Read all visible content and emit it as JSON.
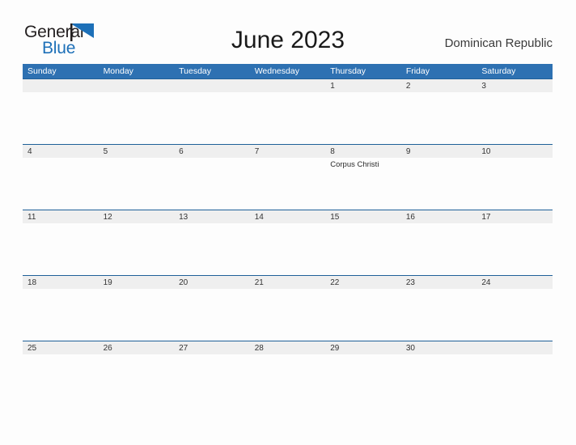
{
  "brand": {
    "name_part1": "General",
    "name_part2": "Blue",
    "flag_color": "#1D70B8",
    "text_color": "#231F20"
  },
  "header": {
    "title": "June 2023",
    "country": "Dominican Republic"
  },
  "theme": {
    "header_blue": "#2E71B2",
    "band_gray": "#EFEFEF",
    "band_line_blue": "#1F6099",
    "page_background": "#FDFDFD"
  },
  "calendar": {
    "weekdays": [
      "Sunday",
      "Monday",
      "Tuesday",
      "Wednesday",
      "Thursday",
      "Friday",
      "Saturday"
    ],
    "weeks": [
      [
        {
          "day": "",
          "events": []
        },
        {
          "day": "",
          "events": []
        },
        {
          "day": "",
          "events": []
        },
        {
          "day": "",
          "events": []
        },
        {
          "day": "1",
          "events": []
        },
        {
          "day": "2",
          "events": []
        },
        {
          "day": "3",
          "events": []
        }
      ],
      [
        {
          "day": "4",
          "events": []
        },
        {
          "day": "5",
          "events": []
        },
        {
          "day": "6",
          "events": []
        },
        {
          "day": "7",
          "events": []
        },
        {
          "day": "8",
          "events": [
            "Corpus Christi"
          ]
        },
        {
          "day": "9",
          "events": []
        },
        {
          "day": "10",
          "events": []
        }
      ],
      [
        {
          "day": "11",
          "events": []
        },
        {
          "day": "12",
          "events": []
        },
        {
          "day": "13",
          "events": []
        },
        {
          "day": "14",
          "events": []
        },
        {
          "day": "15",
          "events": []
        },
        {
          "day": "16",
          "events": []
        },
        {
          "day": "17",
          "events": []
        }
      ],
      [
        {
          "day": "18",
          "events": []
        },
        {
          "day": "19",
          "events": []
        },
        {
          "day": "20",
          "events": []
        },
        {
          "day": "21",
          "events": []
        },
        {
          "day": "22",
          "events": []
        },
        {
          "day": "23",
          "events": []
        },
        {
          "day": "24",
          "events": []
        }
      ],
      [
        {
          "day": "25",
          "events": []
        },
        {
          "day": "26",
          "events": []
        },
        {
          "day": "27",
          "events": []
        },
        {
          "day": "28",
          "events": []
        },
        {
          "day": "29",
          "events": []
        },
        {
          "day": "30",
          "events": []
        },
        {
          "day": "",
          "events": []
        }
      ]
    ]
  }
}
